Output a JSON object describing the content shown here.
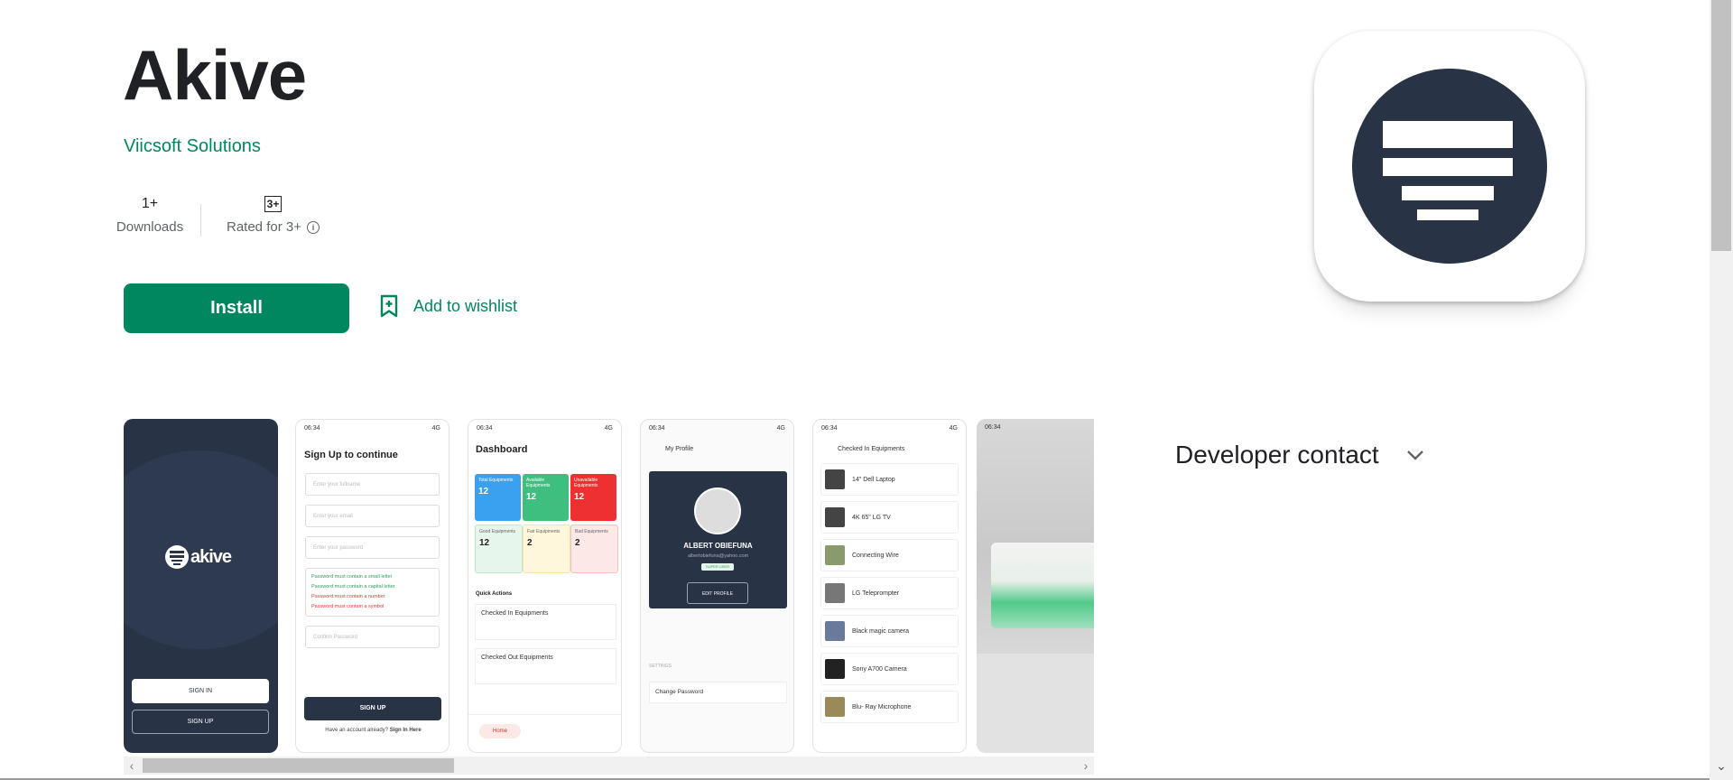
{
  "app": {
    "title": "Akive",
    "developer": "Viicsoft Solutions",
    "stats": {
      "downloads_value": "1+",
      "downloads_label": "Downloads",
      "rating_badge": "3+",
      "rating_label": "Rated for 3+"
    },
    "install_label": "Install",
    "wishlist_label": "Add to wishlist",
    "icon": "akive-menu-lines-icon"
  },
  "sidebar": {
    "developer_contact": "Developer contact"
  },
  "screenshots": {
    "s1": {
      "logo_text": "akive",
      "sign_in": "SIGN IN",
      "sign_up": "SIGN UP"
    },
    "s2": {
      "time": "06:34",
      "net": "4G",
      "heading": "Sign Up to continue",
      "ph_fullname": "Enter your fullname",
      "ph_email": "Enter your email",
      "ph_password": "Enter your password",
      "rules": [
        "Password must contain a small letter",
        "Password must contain a capital letter",
        "Password must contain a number",
        "Password must contain a symbol"
      ],
      "ph_confirm": "Confirm Password",
      "button": "SIGN UP",
      "footer_q": "Have an account already?",
      "footer_link": "Sign In Here"
    },
    "s3": {
      "time": "06:34",
      "net": "4G",
      "heading": "Dashboard",
      "tiles": [
        {
          "label": "Total Equipments",
          "value": "12",
          "color": "#3aa0f0"
        },
        {
          "label": "Available Equipments",
          "value": "12",
          "color": "#3fbf7f"
        },
        {
          "label": "Unavailable Equipments",
          "value": "12",
          "color": "#ee3030"
        },
        {
          "label": "Good Equipments",
          "value": "12",
          "color": "#e7f6ec"
        },
        {
          "label": "Fair Equipments",
          "value": "2",
          "color": "#fff7dc"
        },
        {
          "label": "Bad Equipments",
          "value": "2",
          "color": "#fde8e8"
        }
      ],
      "quick_actions": "Quick Actions",
      "action1": "Checked In Equipments",
      "action2": "Checked Out Equipments",
      "nav_home": "Home"
    },
    "s4": {
      "time": "06:34",
      "net": "4G",
      "heading": "My Profile",
      "name": "ALBERT OBIEFUNA",
      "email": "albertobiefuna@yahoo.com",
      "role": "SUPER USER",
      "edit": "EDIT PROFILE",
      "settings": "SETTINGS",
      "change_pw": "Change Password"
    },
    "s5": {
      "time": "06:34",
      "net": "4G",
      "heading": "Checked In Equipments",
      "items": [
        "14\" Dell Laptop",
        "4K 65\" LG TV",
        "Connecting Wire",
        "LG Teleprompter",
        "Black magic camera",
        "Sony A700 Camera",
        "Blu- Ray Microphone"
      ]
    },
    "s6": {
      "time": "06:34"
    }
  }
}
